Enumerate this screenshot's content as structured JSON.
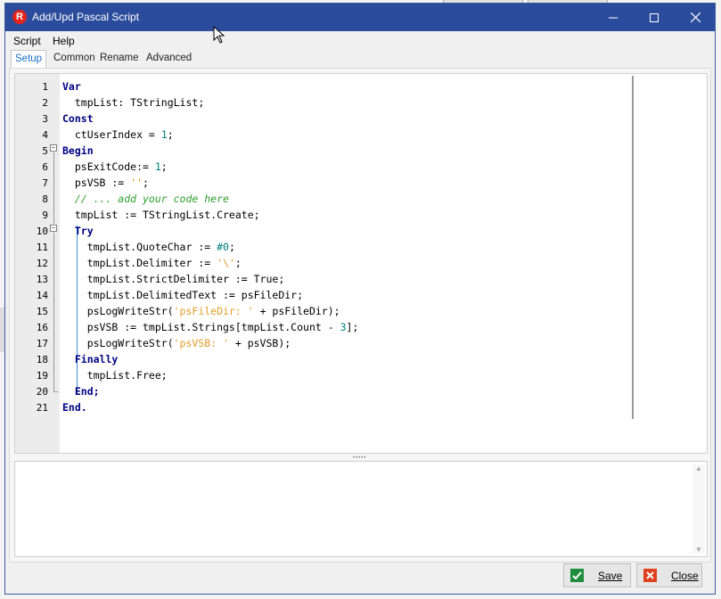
{
  "window": {
    "title": "Add/Upd Pascal Script",
    "app_icon_letter": "R"
  },
  "menu": [
    "Script",
    "Help"
  ],
  "tabs": [
    {
      "label": "Setup",
      "active": true
    },
    {
      "label": "Common",
      "active": false
    },
    {
      "label": "Rename",
      "active": false
    },
    {
      "label": "Advanced",
      "active": false
    }
  ],
  "editor": {
    "line_numbers": [
      "1",
      "2",
      "3",
      "4",
      "5",
      "6",
      "7",
      "8",
      "9",
      "10",
      "11",
      "12",
      "13",
      "14",
      "15",
      "16",
      "17",
      "18",
      "19",
      "20",
      "21"
    ],
    "code": [
      "Var",
      "  tmpList: TStringList;",
      "Const",
      "  ctUserIndex = 1;",
      "Begin",
      "  psExitCode:= 1;",
      "  psVSB := '';",
      "  // ... add your code here",
      "  tmpList := TStringList.Create;",
      "  Try",
      "    tmpList.QuoteChar := #0;",
      "    tmpList.Delimiter := '\\';",
      "    tmpList.StrictDelimiter := True;",
      "    tmpList.DelimitedText := psFileDir;",
      "    psLogWriteStr('psFileDir: ' + psFileDir);",
      "    psVSB := tmpList.Strings[tmpList.Count - 3];",
      "    psLogWriteStr('psVSB: ' + psVSB);",
      "  Finally",
      "    tmpList.Free;",
      "  End;",
      "End."
    ]
  },
  "buttons": {
    "save": "Save",
    "close": "Close"
  },
  "colors": {
    "titlebar": "#2b4c9c",
    "keyword": "#000080",
    "number": "#008080",
    "string": "#e39b28",
    "comment": "#2ca02c",
    "save_icon": "#1e8e3e",
    "close_icon": "#e0401d"
  },
  "icons": {
    "minimize": "minimize-icon",
    "maximize": "maximize-icon",
    "close": "close-icon",
    "save": "checkmark-icon",
    "close_btn": "x-icon"
  }
}
